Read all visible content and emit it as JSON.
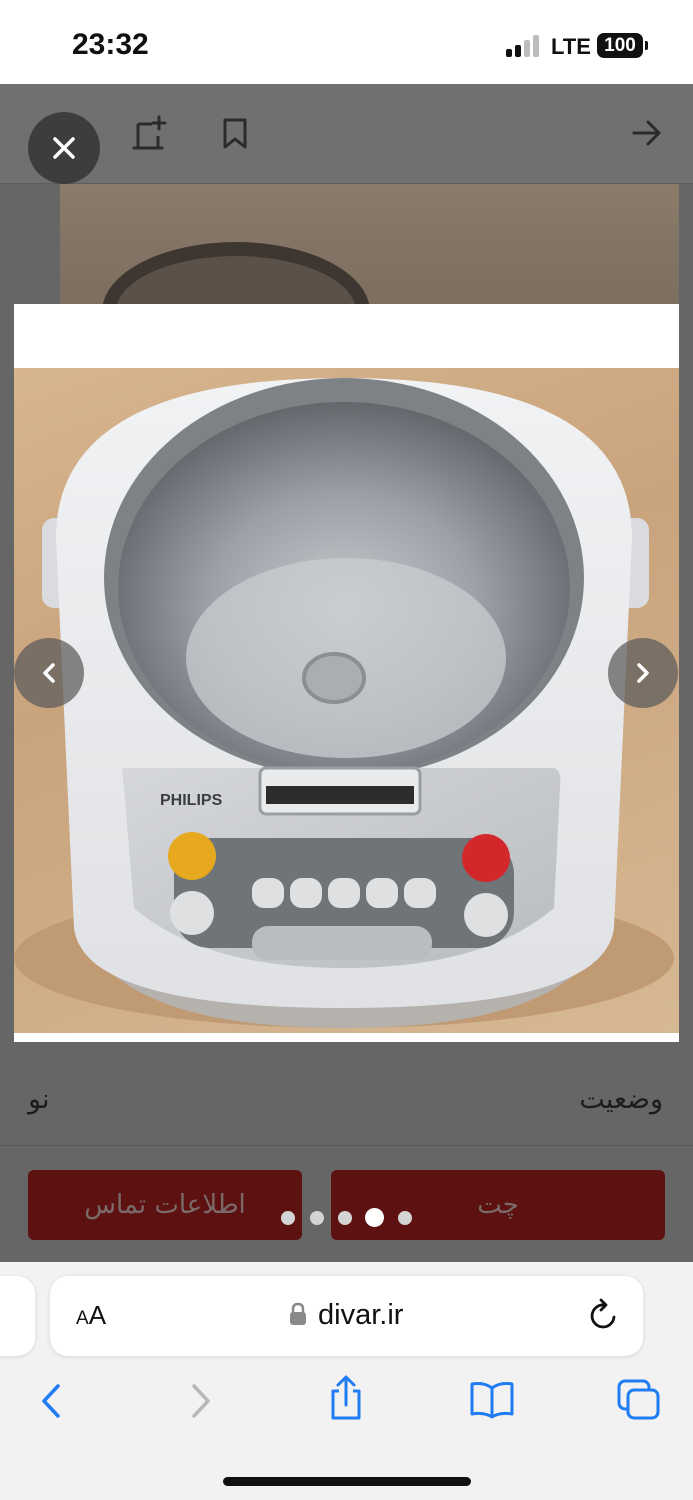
{
  "status_bar": {
    "time": "23:32",
    "network": "LTE",
    "battery": "100"
  },
  "toolbar": {
    "close_icon": "close-icon",
    "add_note_icon": "add-note-icon",
    "bookmark_icon": "bookmark-icon",
    "forward_icon": "arrow-right-icon"
  },
  "gallery": {
    "photo_brand": "PHILIPS",
    "total_images": 5,
    "active_index": 3,
    "prev_icon": "chevron-left-icon",
    "next_icon": "chevron-right-icon"
  },
  "details": {
    "label": "وضعیت",
    "value": "نو"
  },
  "actions": {
    "contact_label": "اطلاعات تماس",
    "chat_label": "چت"
  },
  "browser": {
    "aa_big": "A",
    "aa_small": "A",
    "url": "divar.ir",
    "lock_icon": "lock-icon",
    "reload_icon": "reload-icon",
    "back_icon": "back-icon",
    "forward_icon": "forward-icon",
    "share_icon": "share-icon",
    "bookmarks_icon": "book-icon",
    "tabs_icon": "tabs-icon"
  },
  "colors": {
    "action_button": "#5e1111",
    "overlay": "#666666",
    "accent_blue": "#1f7cf2"
  }
}
